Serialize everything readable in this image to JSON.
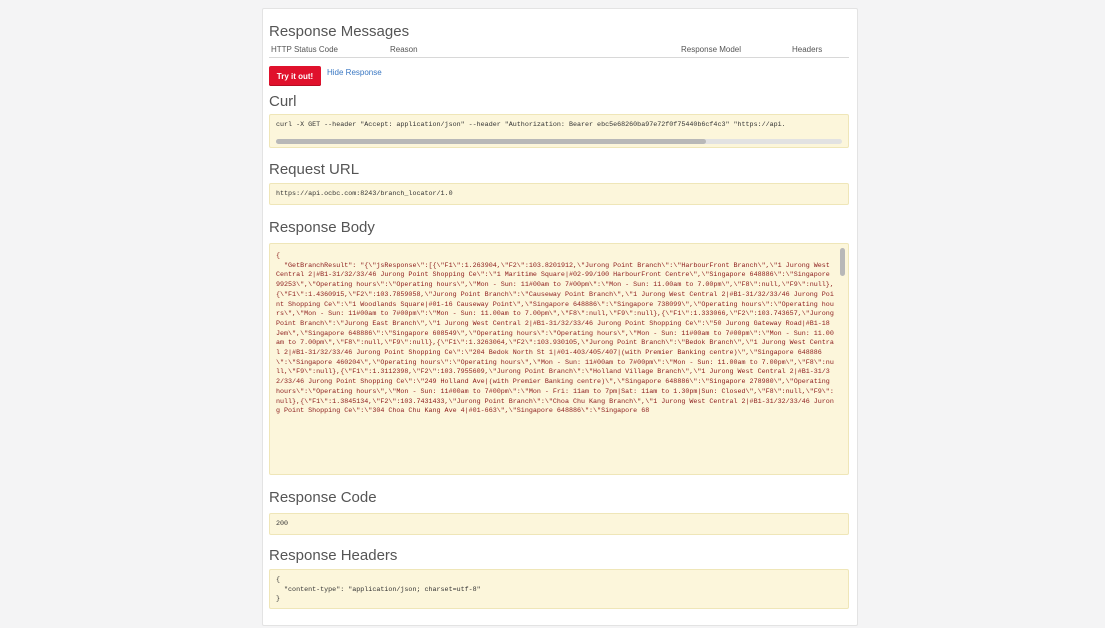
{
  "response_messages": {
    "title": "Response Messages",
    "columns": {
      "status_code": "HTTP Status Code",
      "reason": "Reason",
      "response_model": "Response Model",
      "headers": "Headers"
    }
  },
  "actions": {
    "try_label": "Try it out!",
    "hide_label": "Hide Response"
  },
  "curl": {
    "title": "Curl",
    "command": "curl -X GET --header \"Accept: application/json\" --header \"Authorization: Bearer ebc5e68260ba97e72f0f75440b6cf4c3\" \"https://api."
  },
  "request_url": {
    "title": "Request URL",
    "value": "https://api.ocbc.com:8243/branch_locator/1.0"
  },
  "response_body": {
    "title": "Response Body",
    "content": "{\n  \"GetBranchResult\": \"{\\\"jsResponse\\\":[{\\\"F1\\\":1.263904,\\\"F2\\\":103.8201912,\\\"Jurong Point Branch\\\":\\\"HarbourFront Branch\\\",\\\"1 Jurong West Central 2|#B1-31/32/33/46 Jurong Point Shopping Ce\\\":\\\"1 Maritime Square|#02-99/100 HarbourFront Centre\\\",\\\"Singapore 648886\\\":\\\"Singapore 99253\\\",\\\"Operating hours\\\":\\\"Operating hours\\\",\\\"Mon - Sun: 11#00am to 7#00pm\\\":\\\"Mon - Sun: 11.00am to 7.00pm\\\",\\\"F8\\\":null,\\\"F9\\\":null},{\\\"F1\\\":1.4360915,\\\"F2\\\":103.7859058,\\\"Jurong Point Branch\\\":\\\"Causeway Point Branch\\\",\\\"1 Jurong West Central 2|#B1-31/32/33/46 Jurong Point Shopping Ce\\\":\\\"1 Woodlands Square|#01-16 Causeway Point\\\",\\\"Singapore 648886\\\":\\\"Singapore 738099\\\",\\\"Operating hours\\\":\\\"Operating hours\\\",\\\"Mon - Sun: 11#00am to 7#00pm\\\":\\\"Mon - Sun: 11.00am to 7.00pm\\\",\\\"F8\\\":null,\\\"F9\\\":null},{\\\"F1\\\":1.333066,\\\"F2\\\":103.743657,\\\"Jurong Point Branch\\\":\\\"Jurong East Branch\\\",\\\"1 Jurong West Central 2|#B1-31/32/33/46 Jurong Point Shopping Ce\\\":\\\"50 Jurong Gateway Road|#B1-18 Jem\\\",\\\"Singapore 648886\\\":\\\"Singapore 608549\\\",\\\"Operating hours\\\":\\\"Operating hours\\\",\\\"Mon - Sun: 11#00am to 7#00pm\\\":\\\"Mon - Sun: 11.00am to 7.00pm\\\",\\\"F8\\\":null,\\\"F9\\\":null},{\\\"F1\\\":1.3263064,\\\"F2\\\":103.930105,\\\"Jurong Point Branch\\\":\\\"Bedok Branch\\\",\\\"1 Jurong West Central 2|#B1-31/32/33/46 Jurong Point Shopping Ce\\\":\\\"204 Bedok North St 1|#01-403/405/407|(with Premier Banking centre)\\\",\\\"Singapore 648886\\\":\\\"Singapore 460204\\\",\\\"Operating hours\\\":\\\"Operating hours\\\",\\\"Mon - Sun: 11#00am to 7#00pm\\\":\\\"Mon - Sun: 11.00am to 7.00pm\\\",\\\"F8\\\":null,\\\"F9\\\":null},{\\\"F1\\\":1.3112398,\\\"F2\\\":103.7955609,\\\"Jurong Point Branch\\\":\\\"Holland Village Branch\\\",\\\"1 Jurong West Central 2|#B1-31/32/33/46 Jurong Point Shopping Ce\\\":\\\"249 Holland Ave|(with Premier Banking centre)\\\",\\\"Singapore 648886\\\":\\\"Singapore 278980\\\",\\\"Operating hours\\\":\\\"Operating hours\\\",\\\"Mon - Sun: 11#00am to 7#00pm\\\":\\\"Mon - Fri: 11am to 7pm|Sat: 11am to 1.30pm|Sun: Closed\\\",\\\"F8\\\":null,\\\"F9\\\":null},{\\\"F1\\\":1.3845134,\\\"F2\\\":103.7431433,\\\"Jurong Point Branch\\\":\\\"Choa Chu Kang Branch\\\",\\\"1 Jurong West Central 2|#B1-31/32/33/46 Jurong Point Shopping Ce\\\":\\\"304 Choa Chu Kang Ave 4|#01-663\\\",\\\"Singapore 648886\\\":\\\"Singapore 68"
  },
  "response_code": {
    "title": "Response Code",
    "value": "200"
  },
  "response_headers": {
    "title": "Response Headers",
    "content": "{\n  \"content-type\": \"application/json; charset=utf-8\"\n}"
  }
}
